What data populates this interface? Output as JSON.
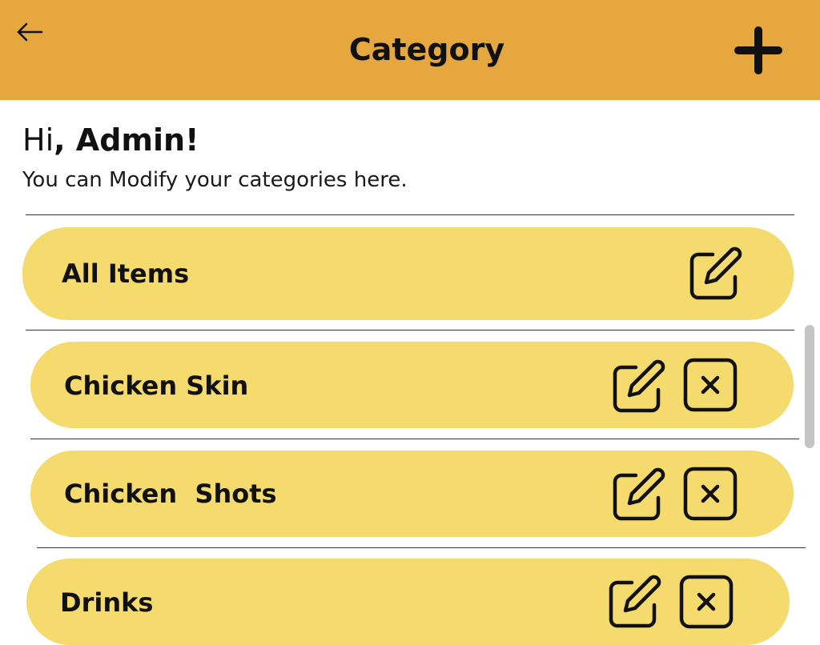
{
  "header": {
    "title": "Category",
    "background": "#e6a83e",
    "back_icon": "arrow-left-icon",
    "add_icon": "plus-icon"
  },
  "greeting": {
    "prefix": "Hi",
    "name": ", Admin!",
    "subtitle": "You can Modify your categories here."
  },
  "card_color": "#f5da6e",
  "categories": [
    {
      "label": "All Items",
      "actions": [
        "edit-icon"
      ]
    },
    {
      "label": "Chicken Skin",
      "actions": [
        "edit-icon",
        "delete-icon"
      ]
    },
    {
      "label": "Chicken  Shots",
      "actions": [
        "edit-icon",
        "delete-icon"
      ]
    },
    {
      "label": "Drinks",
      "actions": [
        "edit-icon",
        "delete-icon"
      ]
    }
  ]
}
